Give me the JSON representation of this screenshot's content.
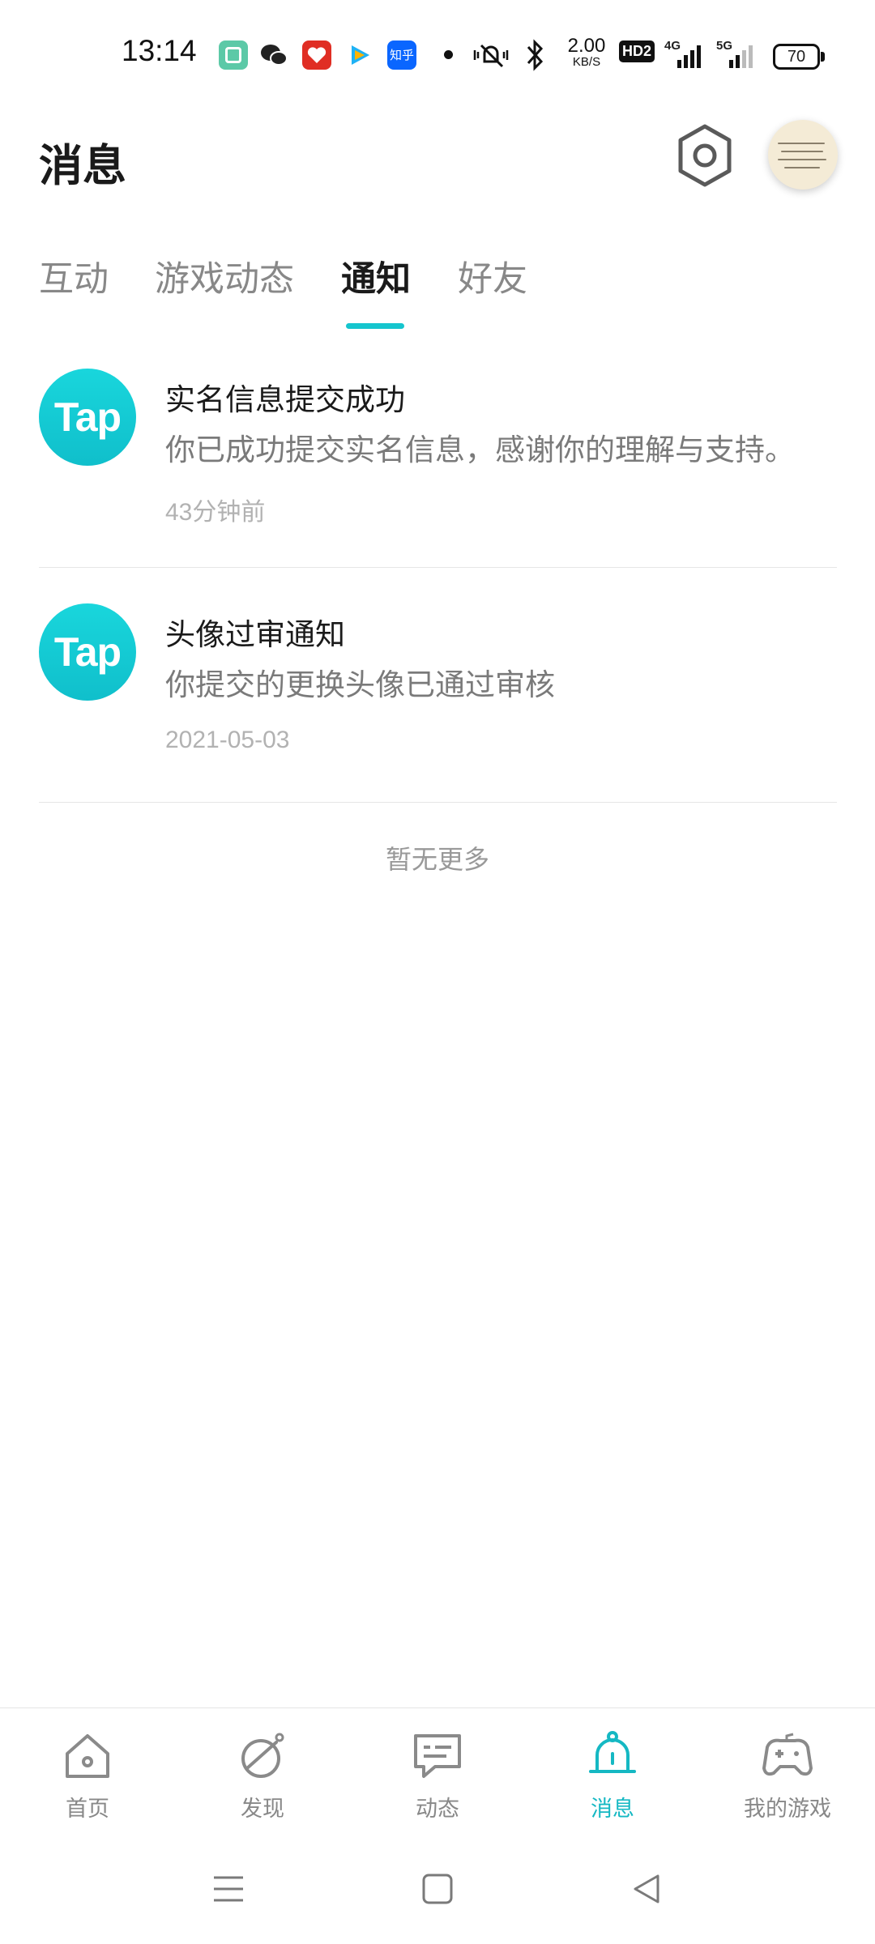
{
  "status_bar": {
    "time": "13:14",
    "speed_value": "2.00",
    "speed_unit": "KB/S",
    "hd_label": "HD2",
    "net_4g": "4G",
    "net_5g": "5G",
    "battery": "70",
    "app_icons": [
      "multitask-icon",
      "wechat-icon",
      "pinduoduo-icon",
      "tencent-video-icon",
      "zhihu-icon"
    ],
    "zhihu_label": "知乎"
  },
  "header": {
    "title": "消息",
    "settings_icon": "settings-hexagon-icon",
    "avatar_icon": "user-avatar"
  },
  "tabs": [
    {
      "label": "互动",
      "active": false
    },
    {
      "label": "游戏动态",
      "active": false
    },
    {
      "label": "通知",
      "active": true
    },
    {
      "label": "好友",
      "active": false
    }
  ],
  "notifications": [
    {
      "icon_text": "Tap",
      "title": "实名信息提交成功",
      "body": "你已成功提交实名信息，感谢你的理解与支持。",
      "time": "43分钟前"
    },
    {
      "icon_text": "Tap",
      "title": "头像过审通知",
      "body": "你提交的更换头像已通过审核",
      "time": "2021-05-03"
    }
  ],
  "list_footer": "暂无更多",
  "bottom_nav": [
    {
      "label": "首页",
      "icon": "home-icon",
      "active": false
    },
    {
      "label": "发现",
      "icon": "discover-planet-icon",
      "active": false
    },
    {
      "label": "动态",
      "icon": "moments-chat-icon",
      "active": false
    },
    {
      "label": "消息",
      "icon": "bell-icon",
      "active": true
    },
    {
      "label": "我的游戏",
      "icon": "gamepad-icon",
      "active": false
    }
  ],
  "colors": {
    "accent": "#15C5CE",
    "text_primary": "#1A1A1A",
    "text_secondary": "#7A7A7A",
    "text_muted": "#B2B2B2"
  }
}
